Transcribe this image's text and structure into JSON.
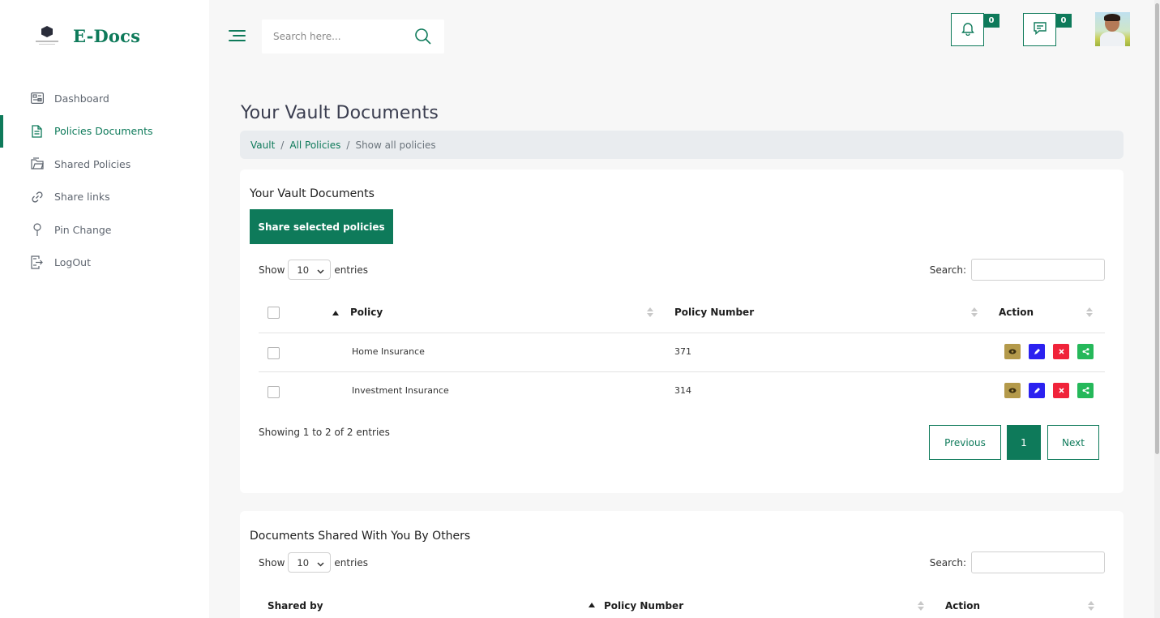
{
  "brand": {
    "name": "E-Docs"
  },
  "sidebar": {
    "items": [
      {
        "label": "Dashboard",
        "icon": "dashboard-icon",
        "active": false
      },
      {
        "label": "Policies Documents",
        "icon": "document-icon",
        "active": true
      },
      {
        "label": "Shared Policies",
        "icon": "folder-icon",
        "active": false
      },
      {
        "label": "Share links",
        "icon": "link-icon",
        "active": false
      },
      {
        "label": "Pin Change",
        "icon": "pin-icon",
        "active": false
      },
      {
        "label": "LogOut",
        "icon": "logout-icon",
        "active": false
      }
    ]
  },
  "header": {
    "search_placeholder": "Search here...",
    "notifications_count": "0",
    "messages_count": "0"
  },
  "page": {
    "title": "Your Vault Documents",
    "breadcrumb": [
      "Vault",
      "All Policies",
      "Show all policies"
    ]
  },
  "vault": {
    "title": "Your Vault Documents",
    "share_button": "Share selected policies",
    "show_label": "Show",
    "page_length": "10",
    "entries_label": "entries",
    "search_label": "Search:",
    "columns": [
      "Policy",
      "Policy Number",
      "Action"
    ],
    "rows": [
      {
        "policy": "Home Insurance",
        "number": "371"
      },
      {
        "policy": "Investment Insurance",
        "number": "314"
      }
    ],
    "info": "Showing 1 to 2 of 2 entries",
    "pagination": {
      "previous": "Previous",
      "current": "1",
      "next": "Next"
    }
  },
  "shared": {
    "title": "Documents Shared With You By Others",
    "show_label": "Show",
    "page_length": "10",
    "entries_label": "entries",
    "search_label": "Search:",
    "columns": [
      "Shared by",
      "Policy Number",
      "Action"
    ]
  },
  "colors": {
    "accent": "#0e7a5a",
    "view": "#b49a4b",
    "edit": "#2b21f0",
    "delete": "#f0233a",
    "share": "#25b85a"
  }
}
